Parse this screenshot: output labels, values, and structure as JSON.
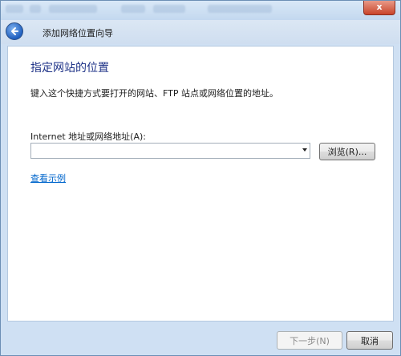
{
  "window": {
    "close_glyph": "x"
  },
  "nav": {
    "title": "添加网络位置向导"
  },
  "main": {
    "heading": "指定网站的位置",
    "instruction": "键入这个快捷方式要打开的网站、FTP 站点或网络位置的地址。",
    "field_label": "Internet 地址或网络地址(A):",
    "address_value": "",
    "browse_label": "浏览(R)...",
    "example_link": "查看示例"
  },
  "footer": {
    "next_label": "下一步(N)",
    "cancel_label": "取消"
  }
}
